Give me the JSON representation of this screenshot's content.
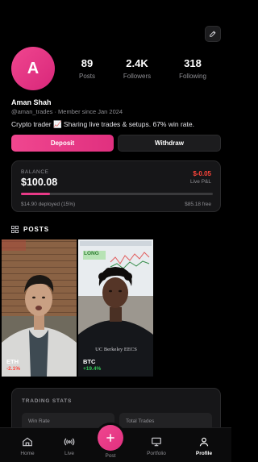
{
  "profile": {
    "initial": "A",
    "name": "Aman Shah",
    "handle_line": "@aman_trades · Member since Jan 2024",
    "bio": "Crypto trader 📈 Sharing live trades & setups. 67% win rate.",
    "stats": [
      {
        "value": "89",
        "label": "Posts"
      },
      {
        "value": "2.4K",
        "label": "Followers"
      },
      {
        "value": "318",
        "label": "Following"
      }
    ],
    "accent": "#E83A87"
  },
  "actions": {
    "deposit": "Deposit",
    "withdraw": "Withdraw"
  },
  "balance": {
    "label": "BALANCE",
    "value": "$100.08",
    "pnl": "$-0.05",
    "pnl_label": "Live P&L",
    "pnl_color": "#FF453A",
    "deployed_text": "$14.90 deployed (15%)",
    "deployed_fraction": 0.15,
    "free_text": "$85.18 free"
  },
  "posts": {
    "title": "POSTS",
    "items": [
      {
        "ticker": "ETH",
        "change": "-2.1%",
        "change_color": "#FF453A"
      },
      {
        "ticker": "BTC",
        "change": "+19.4%",
        "change_color": "#34C759",
        "overlay_badge": "LONG",
        "shirt_text": "UC Berkeley EECS"
      }
    ]
  },
  "trading_stats": {
    "title": "TRADING STATS",
    "cells": [
      "Win Rate",
      "Total Trades"
    ]
  },
  "tabbar": {
    "tabs": [
      {
        "label": "Home",
        "icon": "home-icon"
      },
      {
        "label": "Live",
        "icon": "broadcast-icon"
      },
      {
        "label": "Post",
        "icon": "plus-icon"
      },
      {
        "label": "Portfolio",
        "icon": "monitor-icon"
      },
      {
        "label": "Profile",
        "icon": "person-icon",
        "active": true
      }
    ]
  }
}
